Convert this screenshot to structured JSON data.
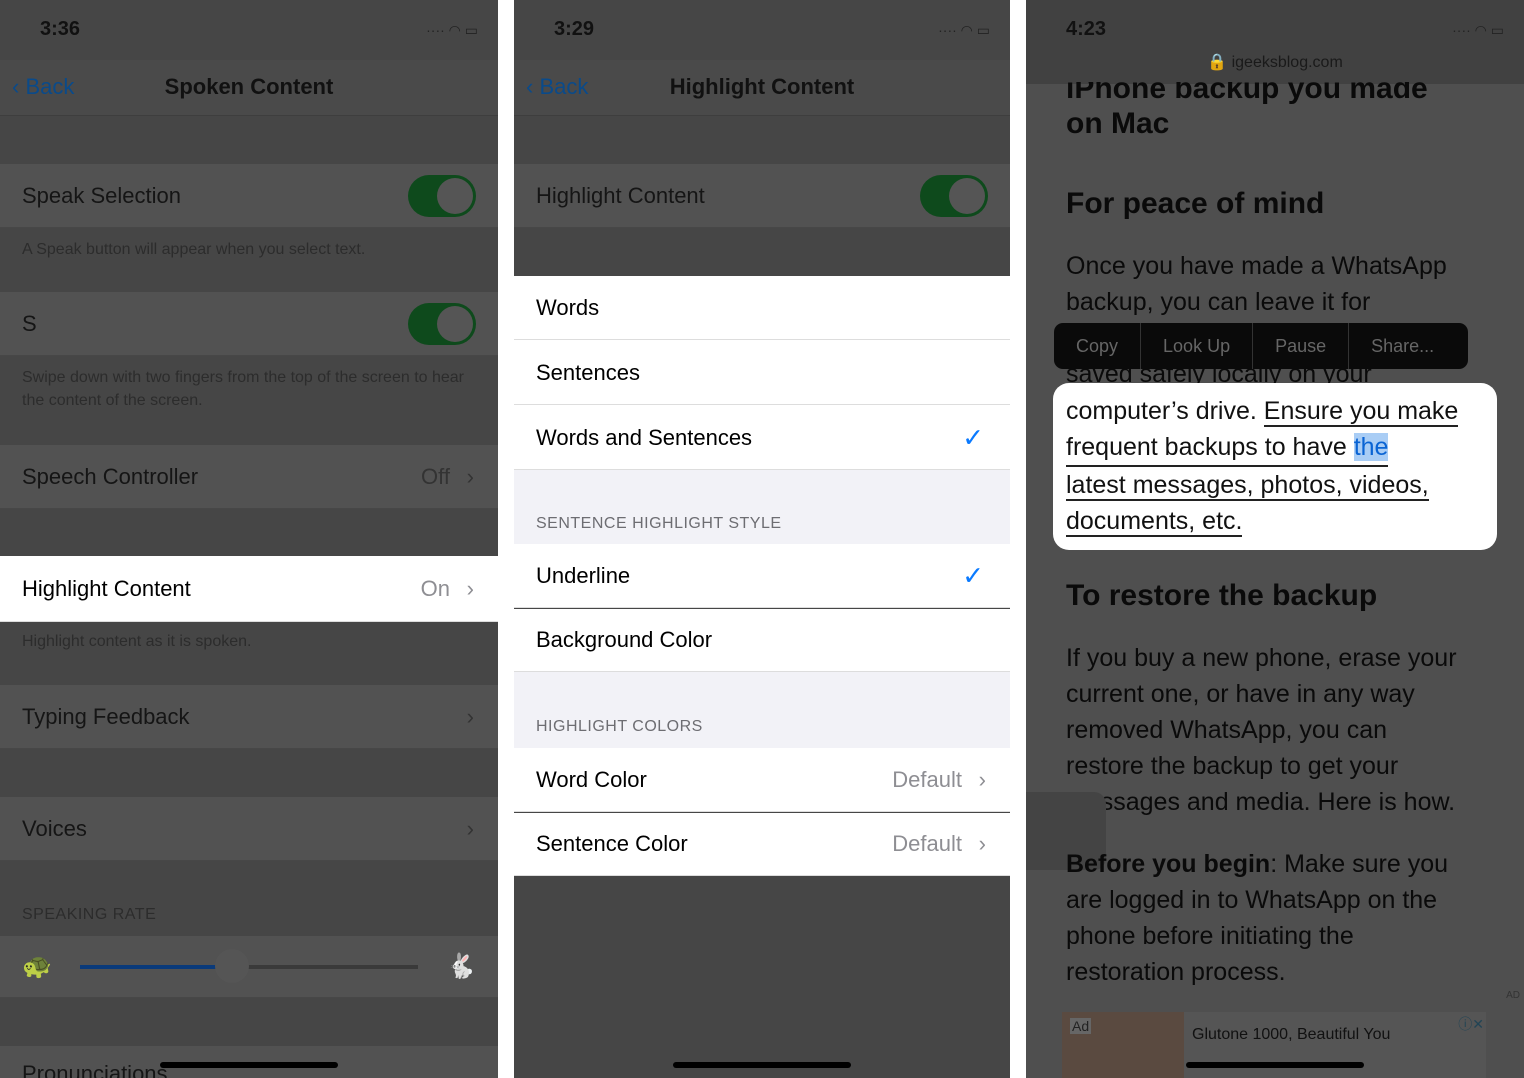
{
  "left": {
    "time": "3:36",
    "back": "Back",
    "title": "Spoken Content",
    "speak_selection": "Speak Selection",
    "speak_selection_note": "A Speak button will appear when you select text.",
    "speak_screen": "S",
    "speak_screen_note": "Swipe down with two fingers from the top of the screen to hear the content of the screen.",
    "speech_controller": "Speech Controller",
    "speech_controller_value": "Off",
    "highlight_content": "Highlight Content",
    "highlight_content_value": "On",
    "highlight_note": "Highlight content as it is spoken.",
    "typing_feedback": "Typing Feedback",
    "voices": "Voices",
    "speaking_rate": "SPEAKING RATE",
    "speaking_rate_fraction": 0.45,
    "pronunciations": "Pronunciations"
  },
  "middle": {
    "time": "3:29",
    "back": "Back",
    "title": "Highlight Content",
    "toggle_label": "Highlight Content",
    "options": [
      "Words",
      "Sentences",
      "Words and Sentences"
    ],
    "selected_option": "Words and Sentences",
    "style_header": "SENTENCE HIGHLIGHT STYLE",
    "styles": [
      "Underline",
      "Background Color"
    ],
    "selected_style": "Underline",
    "colors_header": "HIGHLIGHT COLORS",
    "word_color": "Word Color",
    "word_color_value": "Default",
    "sentence_color": "Sentence Color",
    "sentence_color_value": "Default"
  },
  "right": {
    "time": "4:23",
    "url": "igeeksblog.com",
    "heading_top": "iPhone backup you made",
    "heading_top2": "on Mac",
    "h1": "For peace of mind",
    "p1a": "Once you have made a WhatsApp",
    "p1b": "backup, you can leave it for",
    "p1c": "saved safely locally on your",
    "menu": [
      "Copy",
      "Look Up",
      "Pause",
      "Share..."
    ],
    "card": {
      "t1": "computer’s drive. ",
      "t2": "Ensure you make",
      "t3": "frequent backups to have ",
      "sel": "the",
      "t4": "latest messages, photos, videos,",
      "t5": "documents, etc."
    },
    "h2": "To restore the backup",
    "p2": [
      "If you buy a new phone, erase your",
      "current one, or have in any way",
      "removed WhatsApp, you can",
      "restore the backup to get your",
      "messages and media. Here is how."
    ],
    "p3bold": "Before you begin",
    "p3": [
      ": Make sure you",
      "are logged in to WhatsApp on the",
      "phone before initiating the",
      "restoration process."
    ],
    "ad_badge": "Ad",
    "ad_text": "Glutone 1000, Beautiful You",
    "ad_corner": "AD"
  }
}
